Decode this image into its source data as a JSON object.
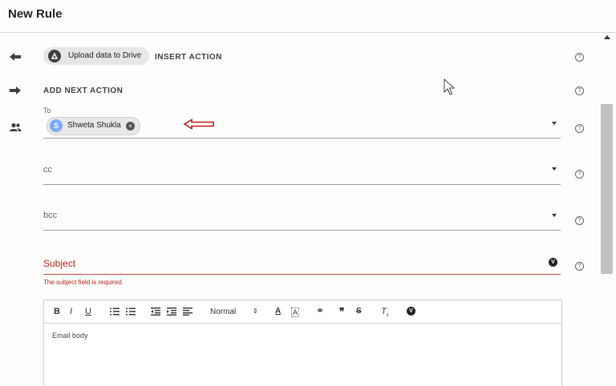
{
  "header": {
    "title": "New Rule"
  },
  "action": {
    "chip_label": "Upload data to Drive",
    "chip_icon": "drive-icon",
    "insert_label": "INSERT ACTION",
    "next_label": "ADD NEXT ACTION"
  },
  "to": {
    "label": "To",
    "recipient_initial": "S",
    "recipient_name": "Shweta Shukla"
  },
  "cc": {
    "placeholder": "cc"
  },
  "bcc": {
    "placeholder": "bcc"
  },
  "subject": {
    "placeholder": "Subject",
    "error": "The subject field is required"
  },
  "editor": {
    "format": "Normal",
    "body_placeholder": "Email body",
    "quote_glyph": "❞"
  },
  "colors": {
    "error": "#b3261e",
    "annotation": "#b71c1c",
    "avatar": "#7baaf7"
  }
}
